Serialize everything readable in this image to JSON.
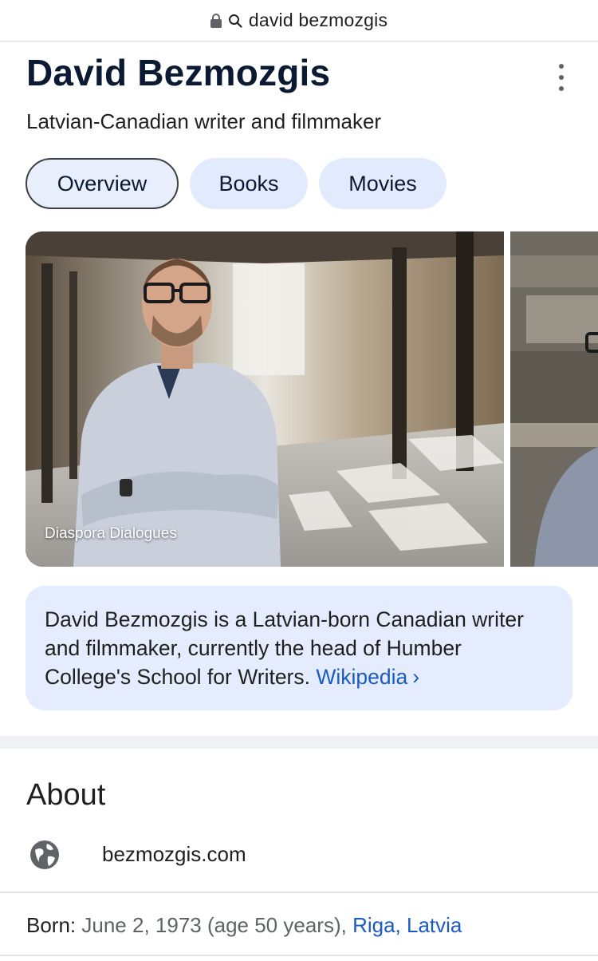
{
  "browser": {
    "url_text": "david bezmozgis"
  },
  "entity": {
    "name": "David Bezmozgis",
    "subtitle": "Latvian-Canadian writer and filmmaker"
  },
  "tabs": [
    {
      "label": "Overview",
      "active": true
    },
    {
      "label": "Books",
      "active": false
    },
    {
      "label": "Movies",
      "active": false
    }
  ],
  "images": {
    "caption": "Diaspora Dialogues"
  },
  "description": {
    "text": "David Bezmozgis is a Latvian-born Canadian writer and filmmaker, currently the head of Humber College's School for Writers. ",
    "source": "Wikipedia",
    "chevron": "›"
  },
  "about": {
    "title": "About",
    "website": "bezmozgis.com",
    "born_label": "Born:",
    "born_value": "June 2, 1973 (age 50 years),",
    "born_place": "Riga, Latvia"
  },
  "colors": {
    "accent_link": "#1a5bc4",
    "chip_bg": "#e2ebfd",
    "title": "#0b1a33"
  }
}
